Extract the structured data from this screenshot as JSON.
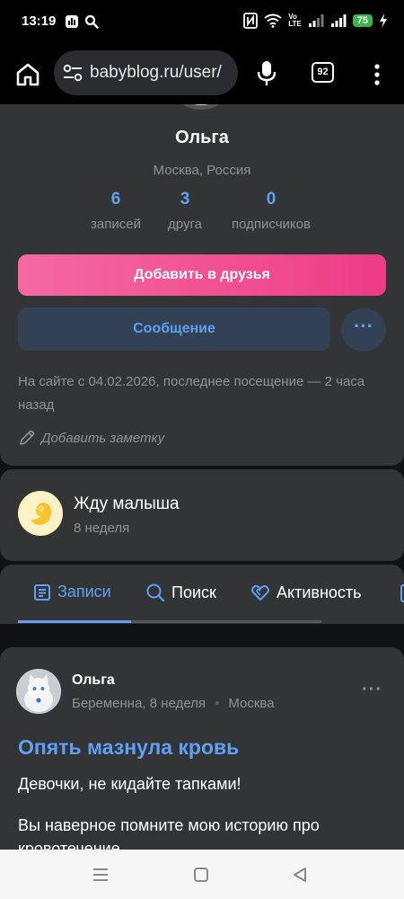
{
  "status_bar": {
    "time": "13:19",
    "lte_top": "Vo",
    "lte_bottom": "LTE",
    "battery": "75"
  },
  "browser": {
    "url": "babyblog.ru/user/",
    "tab_count": "92"
  },
  "profile": {
    "name": "Ольга",
    "location": "Москва, Россия",
    "stats": [
      {
        "value": "6",
        "label": "записей"
      },
      {
        "value": "3",
        "label": "друга"
      },
      {
        "value": "0",
        "label": "подписчиков"
      }
    ],
    "add_friend_label": "Добавить в друзья",
    "message_label": "Сообщение",
    "more_label": "···",
    "visit_text": "На сайте с 04.02.2026, последнее посещение — 2 часа назад",
    "add_note_label": "Добавить заметку"
  },
  "pregnancy": {
    "title": "Жду малыша",
    "week": "8 неделя"
  },
  "tabs": [
    {
      "label": "Записи",
      "icon": "list-icon",
      "active": true
    },
    {
      "label": "Поиск",
      "icon": "search-icon",
      "active": false
    },
    {
      "label": "Активность",
      "icon": "hearts-icon",
      "active": false
    }
  ],
  "post": {
    "author": "Ольга",
    "status": "Беременна, 8 неделя",
    "city": "Москва",
    "more_label": "···",
    "title": "Опять мазнула кровь",
    "paragraph1": "Девочки, не кидайте тапками!",
    "paragraph2": "Вы наверное помните мою историю про кровотечение..."
  },
  "colors": {
    "accent_blue": "#5fa0f4",
    "accent_pink": "#ee3c86",
    "card_bg": "#333436",
    "page_bg": "#111213"
  }
}
